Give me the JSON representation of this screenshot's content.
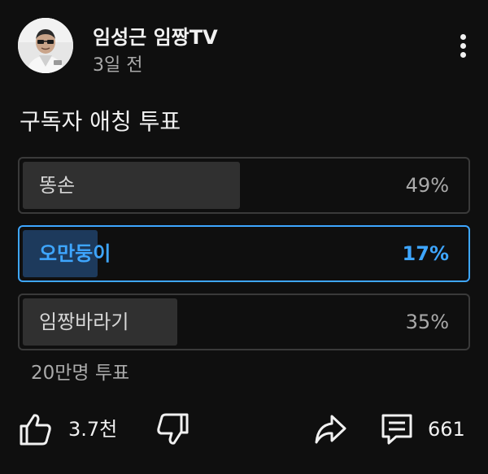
{
  "post": {
    "channel_name": "임성근 임짱TV",
    "time": "3일 전",
    "text": "구독자 애칭 투표",
    "avatar_icon": "channel-avatar"
  },
  "poll": {
    "options": [
      {
        "label": "똥손",
        "percent_text": "49%",
        "percent": 49,
        "selected": false
      },
      {
        "label": "오만둥이",
        "percent_text": "17%",
        "percent": 17,
        "selected": true
      },
      {
        "label": "임짱바라기",
        "percent_text": "35%",
        "percent": 35,
        "selected": false
      }
    ],
    "vote_count": "20만명 투표"
  },
  "actions": {
    "like_count": "3.7천",
    "comment_count": "661",
    "icons": [
      "like-icon",
      "dislike-icon",
      "share-icon",
      "comment-icon",
      "more-vert-icon"
    ]
  },
  "colors": {
    "background": "#0f0f0f",
    "accent": "#3ea6ff",
    "option_fill": "#303030",
    "option_border": "#3a3a3a"
  }
}
